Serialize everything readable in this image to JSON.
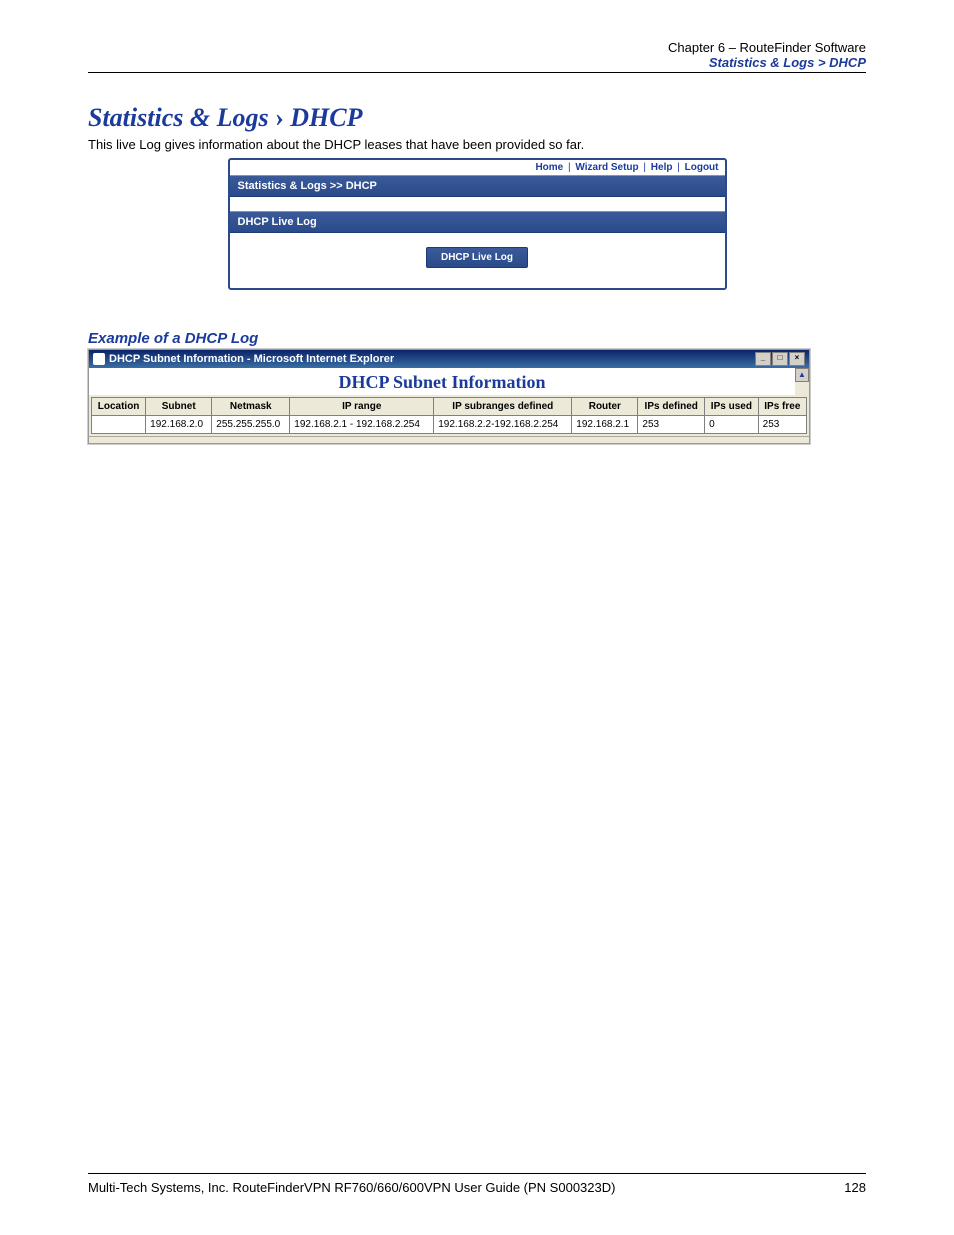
{
  "header": {
    "chapter": "Chapter 6 – RouteFinder Software",
    "breadcrumb": "Statistics & Logs > DHCP"
  },
  "title": {
    "main": "Statistics & Logs",
    "sep": "›",
    "sub": "DHCP"
  },
  "intro": "This live Log gives information about the DHCP leases that have been provided so far.",
  "app": {
    "nav": {
      "home": "Home",
      "wizard": "Wizard Setup",
      "help": "Help",
      "logout": "Logout"
    },
    "breadcrumb": "Statistics & Logs >> DHCP",
    "section_header": "DHCP Live Log",
    "button": "DHCP Live Log"
  },
  "example": {
    "heading": "Example of a DHCP Log",
    "window_title": "DHCP Subnet Information - Microsoft Internet Explorer",
    "page_heading": "DHCP Subnet Information",
    "controls": {
      "min": "_",
      "max": "□",
      "close": "×"
    },
    "scroll_up": "▲",
    "table": {
      "headers": {
        "location": "Location",
        "subnet": "Subnet",
        "netmask": "Netmask",
        "iprange": "IP range",
        "subranges": "IP subranges defined",
        "router": "Router",
        "ips_defined": "IPs defined",
        "ips_used": "IPs used",
        "ips_free": "IPs free"
      },
      "rows": [
        {
          "location": "",
          "subnet": "192.168.2.0",
          "netmask": "255.255.255.0",
          "iprange": "192.168.2.1 - 192.168.2.254",
          "subranges": "192.168.2.2-192.168.2.254",
          "router": "192.168.2.1",
          "ips_defined": "253",
          "ips_used": "0",
          "ips_free": "253"
        }
      ]
    }
  },
  "footer": {
    "left": "Multi-Tech Systems, Inc. RouteFinderVPN RF760/660/600VPN User Guide (PN S000323D)",
    "right": "128"
  }
}
